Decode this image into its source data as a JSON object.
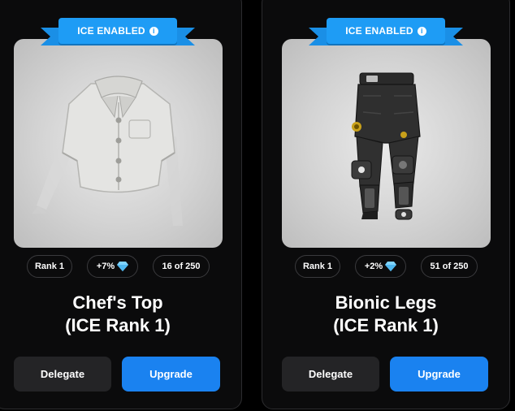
{
  "badge_label": "ICE ENABLED",
  "info_icon": "info-icon",
  "colors": {
    "ribbon": "#1e9cf5",
    "upgrade_button": "#1a82f0",
    "delegate_button": "#242426",
    "diamond": "#7fd3ff"
  },
  "cards": [
    {
      "item_image": "white-short-sleeve-shirt",
      "rank": "Rank 1",
      "boost": "+7%",
      "boost_icon": "diamond-icon",
      "count": "16 of 250",
      "title_line1": "Chef's Top",
      "title_line2": "(ICE Rank 1)",
      "delegate_label": "Delegate",
      "upgrade_label": "Upgrade"
    },
    {
      "item_image": "black-bionic-pants",
      "rank": "Rank 1",
      "boost": "+2%",
      "boost_icon": "diamond-icon",
      "count": "51 of 250",
      "title_line1": "Bionic Legs",
      "title_line2": "(ICE Rank 1)",
      "delegate_label": "Delegate",
      "upgrade_label": "Upgrade"
    }
  ]
}
